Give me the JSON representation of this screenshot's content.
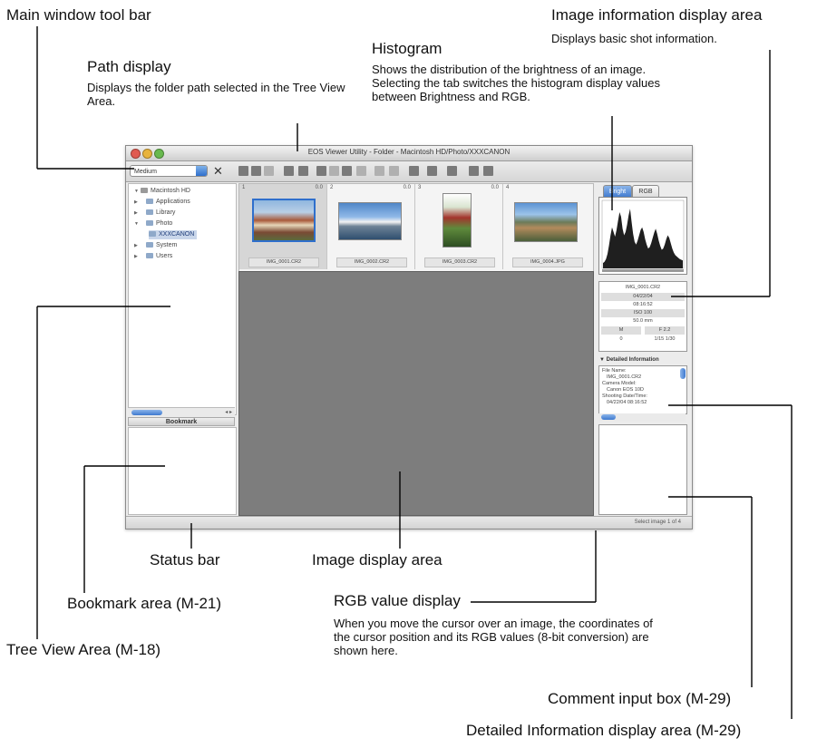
{
  "annotations": {
    "main_toolbar": {
      "title": "Main window tool bar"
    },
    "path_display": {
      "title": "Path display",
      "description": "Displays the folder path selected in the Tree View Area."
    },
    "histogram": {
      "title": "Histogram",
      "description": "Shows the distribution of the brightness of an image. Selecting the tab switches the histogram display values between Brightness and RGB."
    },
    "image_info": {
      "title": "Image information display area",
      "description": "Displays basic shot information."
    },
    "status_bar": {
      "title": "Status bar"
    },
    "image_display": {
      "title": "Image display area"
    },
    "bookmark": {
      "title": "Bookmark area (M-21)"
    },
    "rgb_value": {
      "title": "RGB value display",
      "description": "When you move the cursor over an image, the coordinates of the cursor position and its RGB values (8-bit conversion) are shown here."
    },
    "tree_view": {
      "title": "Tree View Area (M-18)"
    },
    "comment": {
      "title": "Comment input box (M-29)"
    },
    "detailed_info": {
      "title": "Detailed Information display area (M-29)"
    }
  },
  "window": {
    "title": "EOS Viewer Utility - Folder - Macintosh HD/Photo/XXXCANON",
    "size_select": "Medium",
    "close_glyph": "✕",
    "tree": [
      {
        "label": "Macintosh HD",
        "twisty": "▼"
      },
      {
        "label": "Applications",
        "twisty": "▶"
      },
      {
        "label": "Library",
        "twisty": "▶"
      },
      {
        "label": "Photo",
        "twisty": "▼"
      },
      {
        "label": "XXXCANON",
        "twisty": ""
      },
      {
        "label": "System",
        "twisty": "▶"
      },
      {
        "label": "Users",
        "twisty": "▶"
      }
    ],
    "tree_scroll_buttons": "◂ ▸",
    "bookmark_header": "Bookmark",
    "status_text": "Select image 1 of 4",
    "thumbnails": [
      {
        "number": "1",
        "rating": "0.0",
        "caption": "IMG_0001.CR2"
      },
      {
        "number": "2",
        "rating": "0.0",
        "caption": "IMG_0002.CR2"
      },
      {
        "number": "3",
        "rating": "0.0",
        "caption": "IMG_0003.CR2"
      },
      {
        "number": "4",
        "rating": "",
        "caption": "IMG_0004.JPG"
      }
    ],
    "tabs": {
      "brightness": "Bright",
      "rgb": "RGB"
    },
    "histogram_levels": [
      0.08,
      0.1,
      0.14,
      0.22,
      0.35,
      0.5,
      0.62,
      0.55,
      0.48,
      0.58,
      0.72,
      0.85,
      0.78,
      0.6,
      0.5,
      0.55,
      0.66,
      0.8,
      0.9,
      0.7,
      0.52,
      0.4,
      0.36,
      0.42,
      0.5,
      0.58,
      0.62,
      0.55,
      0.44,
      0.36,
      0.3,
      0.32,
      0.38,
      0.46,
      0.54,
      0.6,
      0.52,
      0.42,
      0.34,
      0.28,
      0.3,
      0.36,
      0.44,
      0.5,
      0.46,
      0.38,
      0.3,
      0.24,
      0.2,
      0.18,
      0.16,
      0.14,
      0.13,
      0.12
    ],
    "info": {
      "filename": "IMG_0001.CR2",
      "date": "04/22/04",
      "time": "08:16:52",
      "iso": "ISO 100",
      "focal": "50.0 mm",
      "av_label": "M",
      "av_value": "F 2.2",
      "tv_label": "0",
      "tv_value": "1/15 1/30"
    },
    "detail_header": "▼ Detailed Information",
    "detail_lines": [
      "File Name:",
      "IMG_0001.CR2",
      "Camera Model:",
      "Canon EOS 10D",
      "Shooting Date/Time:",
      "04/22/04 08:16:52"
    ],
    "accent_color": "#3d78ce",
    "toolbar_icons": [
      "thumb-small-icon",
      "thumb-medium-icon",
      "thumb-large-icon",
      "rotate-left-icon",
      "rotate-right-icon",
      "check-icon",
      "remove-check-icon",
      "slideshow-icon",
      "compare-icon",
      "zoom-icon",
      "minus-icon",
      "pencil-icon",
      "copy-icon",
      "save-icon",
      "print-icon",
      "printer-icon"
    ]
  }
}
